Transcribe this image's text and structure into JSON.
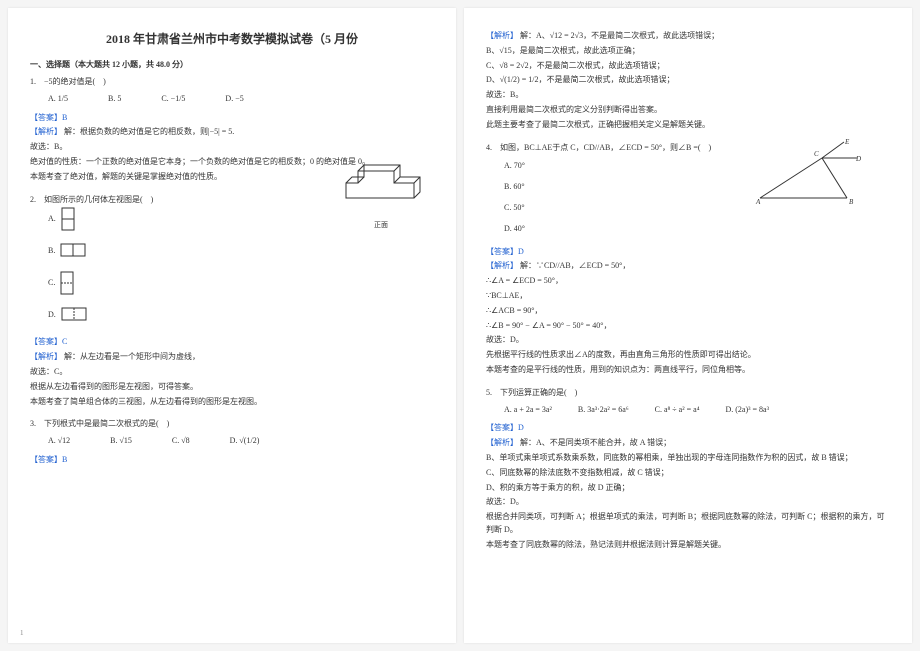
{
  "title": "2018 年甘肃省兰州市中考数学模拟试卷（5 月份",
  "section1": "一、选择题（本大题共 12 小题，共 48.0 分）",
  "q1": {
    "stem": "1.　−5的绝对值是(　)",
    "A": "A. 1/5",
    "B": "B. 5",
    "C": "C. −1/5",
    "D": "D. −5",
    "ans": "【答案】B",
    "exp_label": "【解析】",
    "exp_body": "解：根据负数的绝对值是它的相反数，则|−5| = 5.",
    "l1": "故选：B。",
    "l2": "绝对值的性质：一个正数的绝对值是它本身；一个负数的绝对值是它的相反数；0 的绝对值是 0。",
    "l3": "本题考查了绝对值，解题的关键是掌握绝对值的性质。"
  },
  "q2": {
    "stem": "2.　如图所示的几何体左视图是(　)",
    "A": "A.",
    "B": "B.",
    "C": "C.",
    "D": "D.",
    "caption": "正面",
    "ans": "【答案】C",
    "exp_label": "【解析】",
    "exp_body": "解：从左边看是一个矩形中间为虚线，",
    "l1": "故选：C。",
    "l2": "根据从左边看得到的图形是左视图，可得答案。",
    "l3": "本题考查了简单组合体的三视图，从左边看得到的图形是左视图。"
  },
  "q3": {
    "stem": "3.　下列根式中是最简二次根式的是(　)",
    "A": "A. √12",
    "B": "B. √15",
    "C": "C. √8",
    "D": "D. √(1/2)",
    "ans": "【答案】B"
  },
  "page2": {
    "r1_label": "【解析】",
    "r1_body": "解：A、√12 = 2√3，不是最简二次根式，故此选项错误；",
    "r2": "B、√15，是最简二次根式，故此选项正确；",
    "r3": "C、√8 = 2√2，不是最简二次根式，故此选项错误；",
    "r4": "D、√(1/2) = 1/2，不是最简二次根式，故此选项错误；",
    "r5": "故选：B。",
    "r6": "直接利用最简二次根式的定义分别判断得出答案。",
    "r7": "此题主要考查了最简二次根式，正确把握相关定义是解题关键。"
  },
  "q4": {
    "stem": "4.　如图，BC⊥AE于点 C，CD//AB，∠ECD = 50°，则∠B =(　)",
    "A": "A. 70°",
    "B": "B. 60°",
    "C": "C. 50°",
    "D": "D. 40°",
    "ans": "【答案】D",
    "exp_label": "【解析】",
    "exp_body": "解：∵CD//AB，∠ECD = 50°，",
    "l1": "∴∠A = ∠ECD = 50°，",
    "l2": "∵BC⊥AE，",
    "l3": "∴∠ACB = 90°，",
    "l4": "∴∠B = 90° − ∠A = 90° − 50° = 40°，",
    "l5": "故选：D。",
    "l6": "先根据平行线的性质求出∠A的度数，再由直角三角形的性质即可得出结论。",
    "l7": "本题考查的是平行线的性质，用到的知识点为：两直线平行，同位角相等。"
  },
  "q5": {
    "stem": "5.　下列运算正确的是(　)",
    "A": "A. a + 2a = 3a²",
    "B": "B. 3a³·2a² = 6a⁶",
    "C": "C. a⁸ ÷ a² = a⁴",
    "D": "D. (2a)³ = 8a³",
    "ans": "【答案】D",
    "exp_label": "【解析】",
    "exp_body": "解：A、不是同类项不能合并，故 A 错误；",
    "l1": "B、单项式乘单项式系数乘系数，同底数的幂相乘，单独出现的字母连同指数作为积的因式，故 B 错误；",
    "l2": "C、同底数幂的除法底数不变指数相减，故 C 错误；",
    "l3": "D、积的乘方等于乘方的积，故 D 正确；",
    "l4": "故选：D。",
    "l5": "根据合并同类项，可判断 A；根据单项式的乘法，可判断 B；根据同底数幂的除法，可判断 C；根据积的乘方，可判断 D。",
    "l6": "本题考查了同底数幂的除法，熟记法则并根据法则计算是解题关键。"
  },
  "pagenum": "1",
  "labels": {
    "E": "E",
    "D": "D",
    "C": "C",
    "A": "A",
    "B": "B"
  }
}
